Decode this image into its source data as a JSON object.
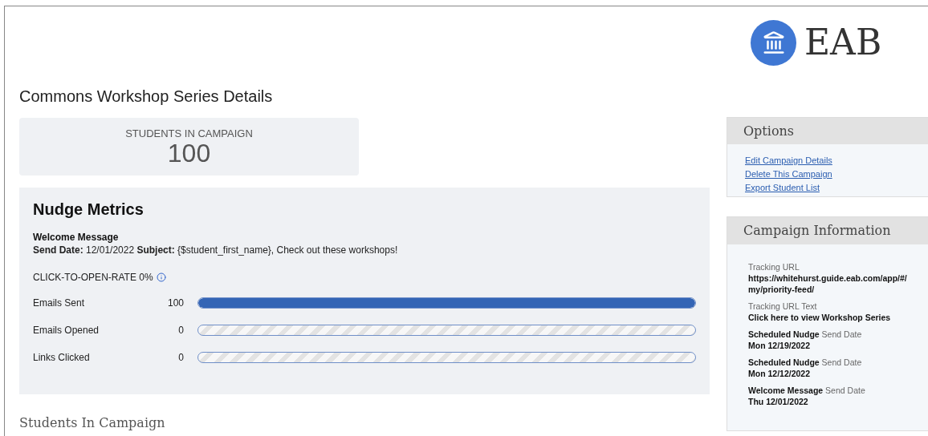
{
  "logo": {
    "text": "EAB"
  },
  "page_title": "Commons Workshop Series Details",
  "stat": {
    "label": "STUDENTS IN CAMPAIGN",
    "value": "100"
  },
  "nudge_metrics": {
    "title": "Nudge Metrics",
    "message_name": "Welcome Message",
    "details": "**Send Date:** 12/01/2022 **Subject:** {$student_first_name}, Check out these workshops!",
    "click_rate": "CLICK-TO-OPEN-RATE 0%",
    "rows": [
      {
        "label": "Emails Sent",
        "count": "100",
        "level": 1
      },
      {
        "label": "Emails Opened",
        "count": "0",
        "level": 0
      },
      {
        "label": "Links Clicked",
        "count": "0",
        "level": 0
      }
    ]
  },
  "students_section": {
    "title": "Students In Campaign"
  },
  "options": {
    "title": "Options",
    "links": [
      "Edit Campaign Details",
      "Delete This Campaign",
      "Export Student List"
    ]
  },
  "campaign_information": {
    "title": "Campaign Information",
    "items": [
      {
        "label": "Tracking URL",
        "value": "https://whitehurst.guide.eab.com/app/#/ my/priority-feed/"
      },
      {
        "label": "Tracking URL Text",
        "value": "Click here to view Workshop Series"
      },
      {
        "label": "**Scheduled Nudge** Send Date",
        "value": "Mon 12/19/2022"
      },
      {
        "label": "**Scheduled Nudge** Send Date",
        "value": "Mon 12/12/2022"
      },
      {
        "label": "**Welcome Message** Send Date",
        "value": "Thu 12/01/2022"
      }
    ]
  }
}
